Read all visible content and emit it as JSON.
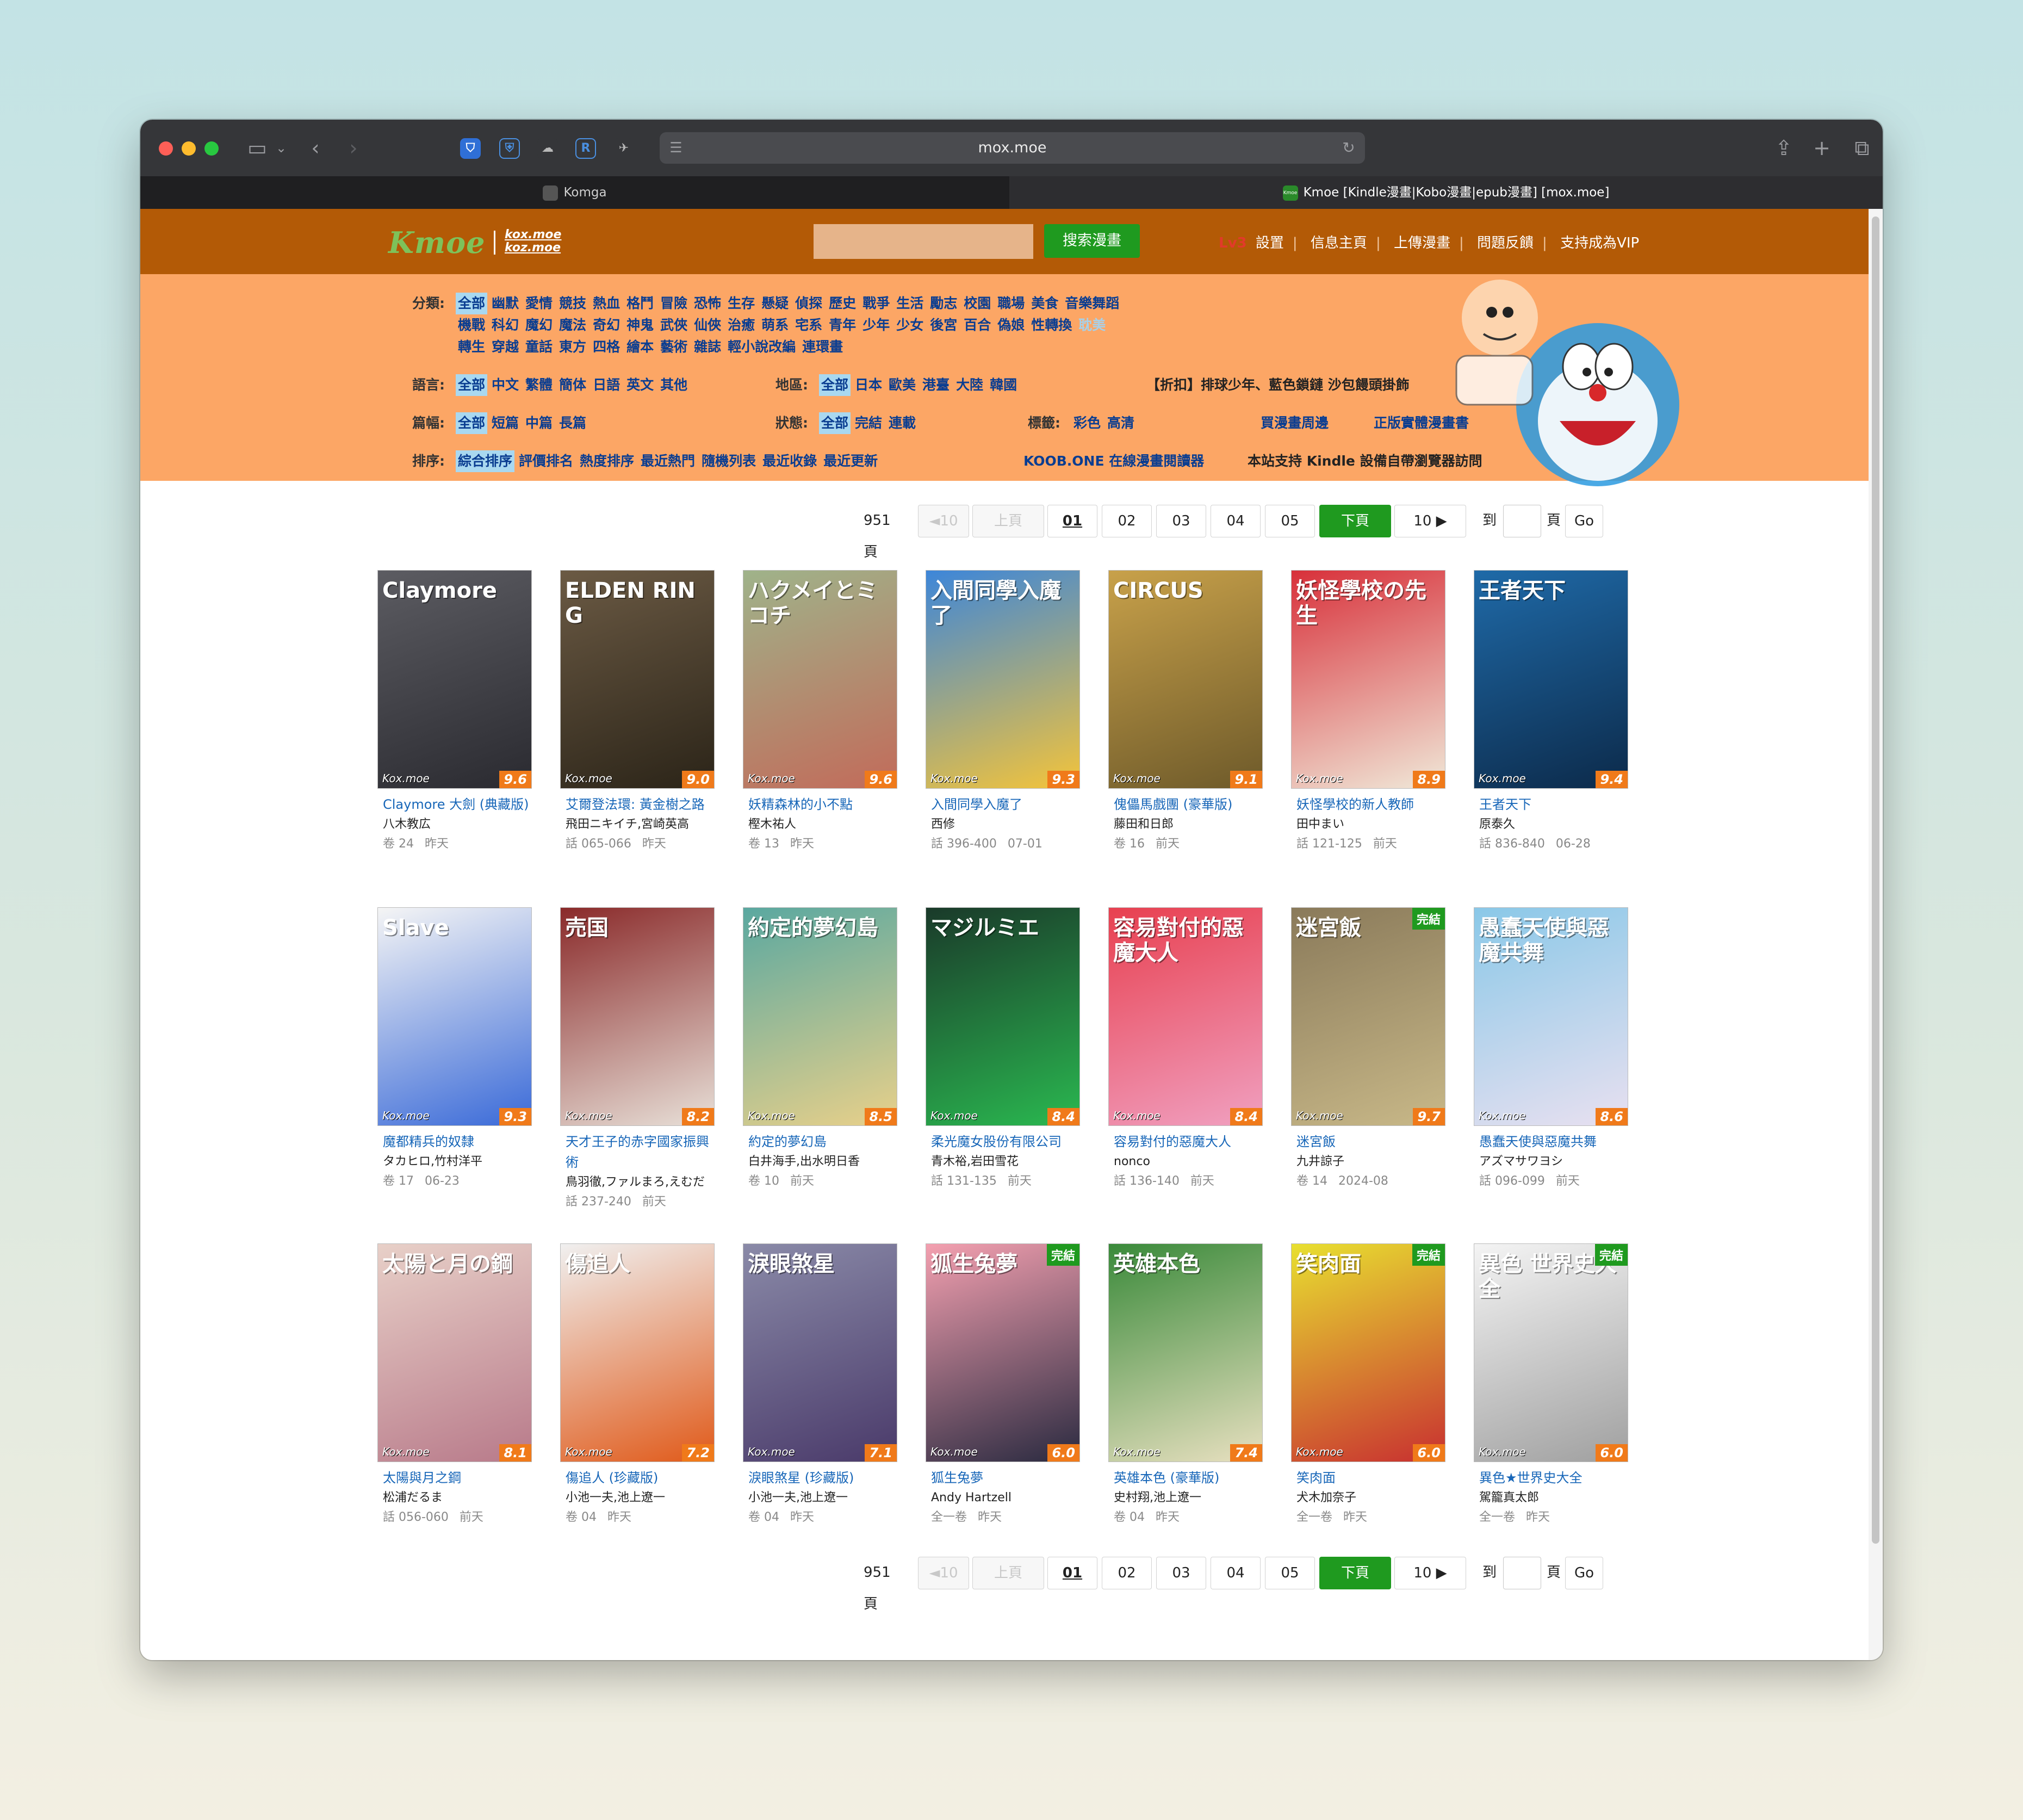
{
  "browser": {
    "url": "mox.moe",
    "tabs": [
      {
        "label": "Komga",
        "active": false
      },
      {
        "label": "Kmoe [Kindle漫畫|Kobo漫畫|epub漫畫] [mox.moe]",
        "active": true
      }
    ],
    "tab_icon_text": "Kmoe",
    "extensions": [
      "bitwarden-icon",
      "shield-icon",
      "cloud-icon",
      "r-extension-icon",
      "pin-icon"
    ]
  },
  "header": {
    "logo": "Kmoe",
    "logo_domains": [
      "kox.moe",
      "koz.moe"
    ],
    "search_button": "搜索漫畫",
    "level": "Lv3",
    "nav": [
      "設置",
      "信息主頁",
      "上傳漫畫",
      "問題反饋",
      "支持成為VIP"
    ]
  },
  "filters": {
    "category_label": "分類:",
    "category_rows": [
      [
        "全部",
        "幽默",
        "愛情",
        "競技",
        "熱血",
        "格鬥",
        "冒險",
        "恐怖",
        "生存",
        "懸疑",
        "偵探",
        "歷史",
        "戰爭",
        "生活",
        "勵志",
        "校園",
        "職場",
        "美食",
        "音樂舞蹈"
      ],
      [
        "機戰",
        "科幻",
        "魔幻",
        "魔法",
        "奇幻",
        "神鬼",
        "武俠",
        "仙俠",
        "治癒",
        "萌系",
        "宅系",
        "青年",
        "少年",
        "少女",
        "後宮",
        "百合",
        "偽娘",
        "性轉換",
        "耽美"
      ],
      [
        "轉生",
        "穿越",
        "童話",
        "東方",
        "四格",
        "繪本",
        "藝術",
        "雜誌",
        "輕小說改編",
        "連環畫"
      ]
    ],
    "language_label": "語言:",
    "languages": [
      "全部",
      "中文",
      "繁體",
      "簡体",
      "日語",
      "英文",
      "其他"
    ],
    "region_label": "地區:",
    "regions": [
      "全部",
      "日本",
      "歐美",
      "港臺",
      "大陸",
      "韓國"
    ],
    "promo": "【折扣】排球少年、藍色鎖鏈 沙包饅頭掛飾",
    "length_label": "篇幅:",
    "lengths": [
      "全部",
      "短篇",
      "中篇",
      "長篇"
    ],
    "status_label": "狀態:",
    "statuses": [
      "全部",
      "完結",
      "連載"
    ],
    "tag_label": "標籤:",
    "tags": [
      "彩色",
      "高清"
    ],
    "link_week": "買漫畫周邊",
    "link_buy": "正版實體漫畫書",
    "sort_label": "排序:",
    "sorts": [
      "綜合排序",
      "評價排名",
      "熱度排序",
      "最近熱門",
      "隨機列表",
      "最近收錄",
      "最近更新"
    ],
    "koob": "KOOB.ONE 在線漫畫閱讀器",
    "kindle_note": "本站支持 Kindle 設備自帶瀏覽器訪問"
  },
  "pagination": {
    "total": "951 頁",
    "prev10": "◄10",
    "prev": "上頁",
    "pages": [
      "01",
      "02",
      "03",
      "04",
      "05"
    ],
    "current": "01",
    "next": "下頁",
    "next10": "10 ▶",
    "goto_label": "到",
    "page_unit": "頁",
    "go": "Go"
  },
  "watermark": "Kox.moe",
  "completed_badge": "完結",
  "mangas": [
    {
      "title": "Claymore 大劍 (典藏版)",
      "author": "八木教広",
      "vol": "卷 24",
      "date": "昨天",
      "score": "9.6",
      "cover_text": "Claymore",
      "colors": [
        "#5c5c62",
        "#2a2a30"
      ],
      "done": false
    },
    {
      "title": "艾爾登法環: 黃金樹之路",
      "author": "飛田ニキイチ,宮崎英高",
      "vol": "話 065-066",
      "date": "昨天",
      "score": "9.0",
      "cover_text": "ELDEN RING",
      "colors": [
        "#6b5a44",
        "#2b2418"
      ],
      "done": false
    },
    {
      "title": "妖精森林的小不點",
      "author": "樫木祐人",
      "vol": "卷 13",
      "date": "昨天",
      "score": "9.6",
      "cover_text": "ハクメイとミコチ",
      "colors": [
        "#9fb38a",
        "#c26b5a"
      ],
      "done": false
    },
    {
      "title": "入間同學入魔了",
      "author": "西修",
      "vol": "話 396-400",
      "date": "07-01",
      "score": "9.3",
      "cover_text": "入間同學入魔了",
      "colors": [
        "#3d86d9",
        "#f4c43a"
      ],
      "done": false
    },
    {
      "title": "傀儡馬戲團 (豪華版)",
      "author": "藤田和日郎",
      "vol": "卷 16",
      "date": "前天",
      "score": "9.1",
      "cover_text": "CIRCUS",
      "colors": [
        "#c8a14a",
        "#6e5a2a"
      ],
      "done": false
    },
    {
      "title": "妖怪學校的新人教師",
      "author": "田中まい",
      "vol": "話 121-125",
      "date": "前天",
      "score": "8.9",
      "cover_text": "妖怪學校の先生",
      "colors": [
        "#d8303a",
        "#f0e8d8"
      ],
      "done": false
    },
    {
      "title": "王者天下",
      "author": "原泰久",
      "vol": "話 836-840",
      "date": "06-28",
      "score": "9.4",
      "cover_text": "王者天下",
      "colors": [
        "#1f6aa8",
        "#0c2a4a"
      ],
      "done": false
    },
    {
      "title": "魔都精兵的奴隸",
      "author": "タカヒロ,竹村洋平",
      "vol": "卷 17",
      "date": "06-23",
      "score": "9.3",
      "cover_text": "Slave",
      "colors": [
        "#f5f5f5",
        "#3a6ad8"
      ],
      "done": false
    },
    {
      "title": "天才王子的赤字國家振興術",
      "author": "鳥羽徹,ファルまろ,えむだ",
      "vol": "話 237-240",
      "date": "前天",
      "score": "8.2",
      "cover_text": "売国",
      "colors": [
        "#8a2a2a",
        "#e8e0d8"
      ],
      "done": false
    },
    {
      "title": "約定的夢幻島",
      "author": "白井海手,出水明日香",
      "vol": "卷 10",
      "date": "前天",
      "score": "8.5",
      "cover_text": "約定的夢幻島",
      "colors": [
        "#5aa8a0",
        "#e8d08a"
      ],
      "done": false
    },
    {
      "title": "柔光魔女股份有限公司",
      "author": "青木裕,岩田雪花",
      "vol": "話 131-135",
      "date": "前天",
      "score": "8.4",
      "cover_text": "マジルミエ",
      "colors": [
        "#1a3a2a",
        "#2ab850"
      ],
      "done": false
    },
    {
      "title": "容易對付的惡魔大人",
      "author": "nonco",
      "vol": "話 136-140",
      "date": "前天",
      "score": "8.4",
      "cover_text": "容易對付的惡魔大人",
      "colors": [
        "#e84050",
        "#f0a0c0"
      ],
      "done": false
    },
    {
      "title": "迷宮飯",
      "author": "九井諒子",
      "vol": "卷 14",
      "date": "2024-08",
      "score": "9.7",
      "cover_text": "迷宮飯",
      "colors": [
        "#8a7a5a",
        "#c8b888"
      ],
      "done": true
    },
    {
      "title": "愚蠢天使與惡魔共舞",
      "author": "アズマサワヨシ",
      "vol": "話 096-099",
      "date": "前天",
      "score": "8.6",
      "cover_text": "愚蠢天使與惡魔共舞",
      "colors": [
        "#8ac8e8",
        "#e8e0f0"
      ],
      "done": false
    },
    {
      "title": "太陽與月之鋼",
      "author": "松浦だるま",
      "vol": "話 056-060",
      "date": "前天",
      "score": "8.1",
      "cover_text": "太陽と月の鋼",
      "colors": [
        "#e8d0c8",
        "#b87a8a"
      ],
      "done": false
    },
    {
      "title": "傷追人 (珍藏版)",
      "author": "小池一夫,池上遼一",
      "vol": "卷 04",
      "date": "昨天",
      "score": "7.2",
      "cover_text": "傷追人",
      "colors": [
        "#f0f0f0",
        "#e05a1a"
      ],
      "done": false
    },
    {
      "title": "淚眼煞星 (珍藏版)",
      "author": "小池一夫,池上遼一",
      "vol": "卷 04",
      "date": "昨天",
      "score": "7.1",
      "cover_text": "淚眼煞星",
      "colors": [
        "#8a8aa8",
        "#4a3a6a"
      ],
      "done": false
    },
    {
      "title": "狐生兔夢",
      "author": "Andy Hartzell",
      "vol": "全一卷",
      "date": "昨天",
      "score": "6.0",
      "cover_text": "狐生兔夢",
      "colors": [
        "#f4a0b0",
        "#2a2a40"
      ],
      "done": true
    },
    {
      "title": "英雄本色 (豪華版)",
      "author": "史村翔,池上遼一",
      "vol": "卷 04",
      "date": "昨天",
      "score": "7.4",
      "cover_text": "英雄本色",
      "colors": [
        "#3a8a3a",
        "#e8e0c0"
      ],
      "done": false
    },
    {
      "title": "笑肉面",
      "author": "犬木加奈子",
      "vol": "全一卷",
      "date": "昨天",
      "score": "6.0",
      "cover_text": "笑肉面",
      "colors": [
        "#e8e030",
        "#c83030"
      ],
      "done": true
    },
    {
      "title": "異色★世界史大全",
      "author": "駕籠真太郎",
      "vol": "全一卷",
      "date": "昨天",
      "score": "6.0",
      "cover_text": "異色 世界史大全",
      "colors": [
        "#f4f4f4",
        "#a0a0a0"
      ],
      "done": true
    }
  ],
  "colors": {
    "header": "#b35a06",
    "filters": "#fca665",
    "accent_green": "#1f9a1f",
    "link_blue": "#1766b8"
  }
}
